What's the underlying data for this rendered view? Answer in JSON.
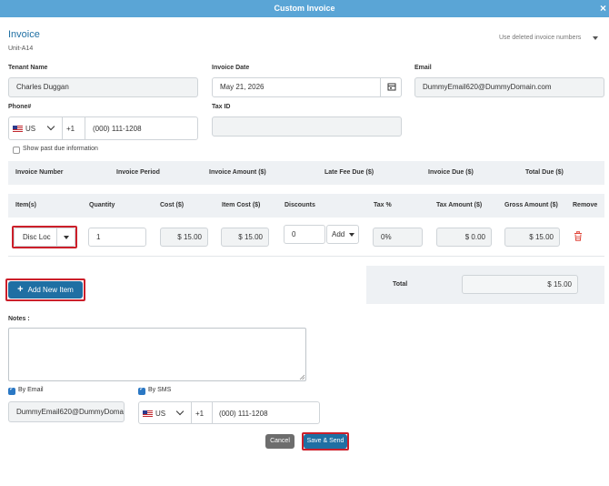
{
  "window": {
    "title": "Custom Invoice",
    "close_glyph": "×"
  },
  "invoice": {
    "heading": "Invoice",
    "unit": "Unit-A14",
    "deleted_toggle": "Use deleted invoice numbers"
  },
  "tenant": {
    "label": "Tenant Name",
    "value": "Charles Duggan"
  },
  "invoice_date": {
    "label": "Invoice Date",
    "value": "May 21, 2026"
  },
  "email": {
    "label": "Email",
    "value": "DummyEmail620@DummyDomain.com"
  },
  "phone": {
    "label": "Phone#",
    "country": "US",
    "code": "+1",
    "number": "(000) 111-1208"
  },
  "tax_id": {
    "label": "Tax ID",
    "value": ""
  },
  "past_due": {
    "label": "Show past due information",
    "checked": false
  },
  "summary_headers": [
    "Invoice Number",
    "Invoice Period",
    "Invoice Amount ($)",
    "Late Fee Due ($)",
    "Invoice Due ($)",
    "Total Due ($)"
  ],
  "item_headers": [
    "Item(s)",
    "Quantity",
    "Cost ($)",
    "Item Cost ($)",
    "Discounts",
    "Tax %",
    "Tax Amount ($)",
    "Gross Amount ($)",
    "Remove"
  ],
  "item_row": {
    "item": "Disc Loc",
    "quantity": "1",
    "cost": "$ 15.00",
    "item_cost": "$ 15.00",
    "discount": "0",
    "discount_mode": "Add",
    "tax_pct": "0%",
    "tax_amount": "$ 0.00",
    "gross_amount": "$ 15.00"
  },
  "add_item_button": "Add New Item",
  "total": {
    "label": "Total",
    "value": "$ 15.00"
  },
  "notes": {
    "label": "Notes :",
    "value": ""
  },
  "send": {
    "by_email_label": "By Email",
    "by_email_checked": true,
    "by_sms_label": "By SMS",
    "by_sms_checked": true,
    "email_value": "DummyEmail620@DummyDomain.com",
    "sms_country": "US",
    "sms_code": "+1",
    "sms_number": "(000) 111-1208"
  },
  "buttons": {
    "cancel": "Cancel",
    "save_send": "Save & Send"
  },
  "colors": {
    "titlebar": "#5aa5d6",
    "primary": "#1f6fa3",
    "highlight": "#cc1f2a",
    "remove_icon": "#e0453a"
  },
  "icons": {
    "calendar": "calendar-icon",
    "trash": "trash-icon",
    "plus": "plus-icon"
  }
}
